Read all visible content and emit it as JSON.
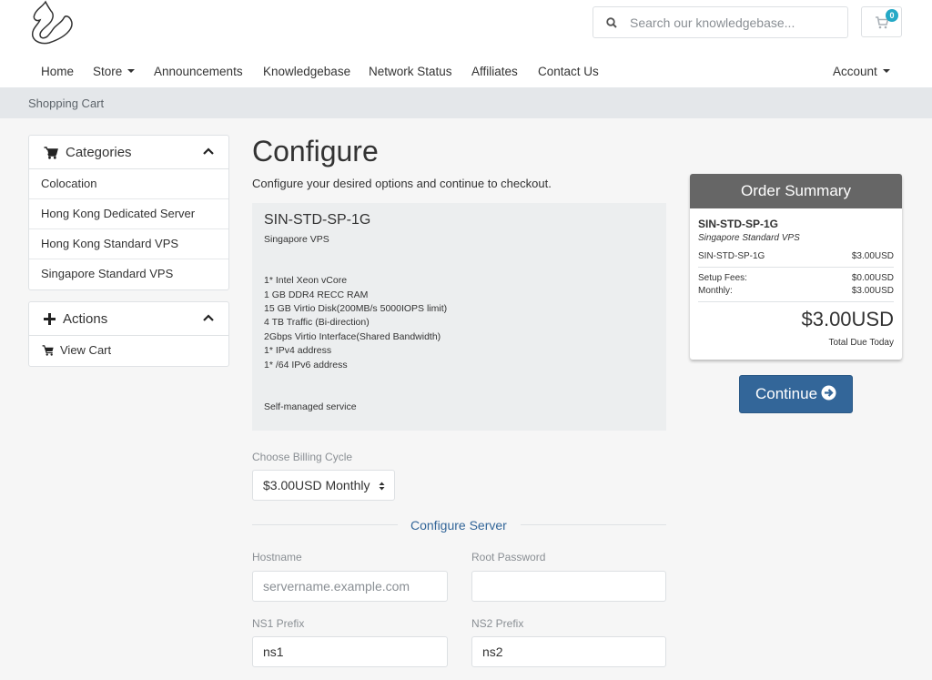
{
  "header": {
    "search": {
      "placeholder": "Search our knowledgebase..."
    },
    "cart": {
      "count": "0"
    }
  },
  "nav": {
    "items": [
      {
        "label": "Home"
      },
      {
        "label": "Store"
      },
      {
        "label": "Announcements"
      },
      {
        "label": "Knowledgebase"
      },
      {
        "label": "Network Status"
      },
      {
        "label": "Affiliates"
      },
      {
        "label": "Contact Us"
      }
    ],
    "account": "Account"
  },
  "breadcrumb": "Shopping Cart",
  "sidebar": {
    "categories": {
      "title": "Categories",
      "items": [
        {
          "label": "Colocation"
        },
        {
          "label": "Hong Kong Dedicated Server"
        },
        {
          "label": "Hong Kong Standard VPS"
        },
        {
          "label": "Singapore Standard VPS"
        }
      ]
    },
    "actions": {
      "title": "Actions",
      "items": [
        {
          "label": "View Cart"
        }
      ]
    }
  },
  "main": {
    "title": "Configure",
    "subtitle": "Configure your desired options and continue to checkout.",
    "product": {
      "name": "SIN-STD-SP-1G",
      "group": "Singapore VPS",
      "specs": [
        "1* Intel Xeon vCore",
        "1 GB DDR4 RECC RAM",
        "15 GB Virtio Disk(200MB/s 5000IOPS limit)",
        "4 TB Traffic (Bi-direction)",
        "2Gbps Virtio Interface(Shared Bandwidth)",
        "1* IPv4 address",
        "1* /64 IPv6 address"
      ],
      "note": "Self-managed service"
    },
    "billing": {
      "label": "Choose Billing Cycle",
      "selected": "$3.00USD Monthly"
    },
    "configure_server": {
      "title": "Configure Server",
      "hostname": {
        "label": "Hostname",
        "placeholder": "servername.example.com",
        "value": ""
      },
      "root_password": {
        "label": "Root Password",
        "value": ""
      },
      "ns1": {
        "label": "NS1 Prefix",
        "value": "ns1"
      },
      "ns2": {
        "label": "NS2 Prefix",
        "value": "ns2"
      }
    }
  },
  "summary": {
    "title": "Order Summary",
    "product_name": "SIN-STD-SP-1G",
    "product_group": "Singapore Standard VPS",
    "line_label": "SIN-STD-SP-1G",
    "line_price": "$3.00USD",
    "setup_label": "Setup Fees:",
    "setup_value": "$0.00USD",
    "monthly_label": "Monthly:",
    "monthly_value": "$3.00USD",
    "total": "$3.00USD",
    "total_label": "Total Due Today"
  },
  "continue": {
    "label": "Continue"
  }
}
